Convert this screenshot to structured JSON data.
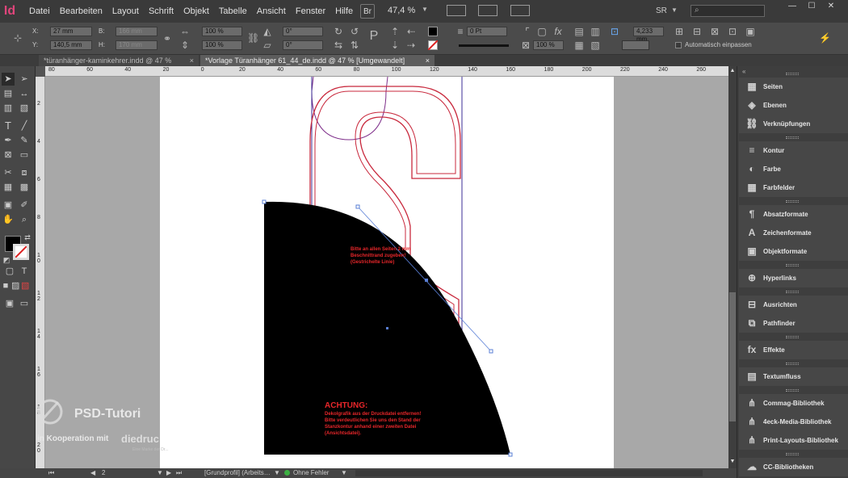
{
  "app": {
    "logo": "Id"
  },
  "menu": [
    "Datei",
    "Bearbeiten",
    "Layout",
    "Schrift",
    "Objekt",
    "Tabelle",
    "Ansicht",
    "Fenster",
    "Hilfe"
  ],
  "menubar": {
    "br_button": "Br",
    "zoom": "47,4 %",
    "workspace": "SR",
    "search_placeholder": ""
  },
  "window_controls": {
    "minimize": "—",
    "maximize": "☐",
    "close": "✕"
  },
  "control": {
    "x_label": "X:",
    "x_value": "27 mm",
    "y_label": "Y:",
    "y_value": "140,5 mm",
    "b_label": "B:",
    "b_value": "166 mm",
    "h_label": "H:",
    "h_value": "170 mm",
    "scale_x": "100 %",
    "scale_y": "100 %",
    "angle1": "0°",
    "angle2": "0°",
    "stroke_weight": "0 Pt",
    "opacity": "100 %",
    "offset": "4,233 mm",
    "autofit": "Automatisch einpassen"
  },
  "tabs": [
    {
      "label": "*türanhänger-kaminkehrer.indd @ 47 %",
      "close": "×"
    },
    {
      "label": "*Vorlage Türanhänger 61_44_de.indd @ 47 % [Umgewandelt]",
      "close": "×"
    }
  ],
  "ruler_top": [
    "80",
    "60",
    "40",
    "20",
    "0",
    "20",
    "40",
    "60",
    "80",
    "100",
    "120",
    "140",
    "160",
    "180",
    "200",
    "220",
    "240",
    "260"
  ],
  "ruler_left": [
    "2",
    "4",
    "6",
    "8",
    "1\n0",
    "1\n2",
    "1\n4",
    "1\n6",
    "1\n8",
    "2\n0"
  ],
  "canvas": {
    "note1": [
      "Bitte an allen Seiten 2 mm",
      "Beschnittrand zugeben!",
      "(Gestrichelte Linie)"
    ],
    "warning_title": "ACHTUNG:",
    "warning_lines": [
      "Dekolgrafik aus der Druckdatei entfernen!",
      "Bitte verdeutlichen Sie uns den Stand der",
      "Stanzkontur anhand einer zweiten Datei",
      "(Ansichtsdatei)."
    ]
  },
  "status": {
    "page": "2",
    "profile": "[Grundprofil] (Arbeits…",
    "errors": "Ohne Fehler"
  },
  "watermark": {
    "brand": "PSD-Tutori",
    "coop": "in Kooperation mit",
    "partner": "diedruc",
    "tag": "Eine Marke der Dr..."
  },
  "panels": [
    {
      "group": [
        {
          "icon": "pages-icon",
          "glyph": "▦",
          "label": "Seiten"
        },
        {
          "icon": "layers-icon",
          "glyph": "◈",
          "label": "Ebenen"
        },
        {
          "icon": "links-icon",
          "glyph": "⛓",
          "label": "Verknüpfungen"
        }
      ]
    },
    {
      "group": [
        {
          "icon": "stroke-icon",
          "glyph": "≡",
          "label": "Kontur"
        },
        {
          "icon": "color-icon",
          "glyph": "◐",
          "label": "Farbe"
        },
        {
          "icon": "swatches-icon",
          "glyph": "▦",
          "label": "Farbfelder"
        }
      ]
    },
    {
      "group": [
        {
          "icon": "paragraph-styles-icon",
          "glyph": "¶",
          "label": "Absatzformate"
        },
        {
          "icon": "character-styles-icon",
          "glyph": "A",
          "label": "Zeichenformate"
        },
        {
          "icon": "object-styles-icon",
          "glyph": "▣",
          "label": "Objektformate"
        }
      ]
    },
    {
      "group": [
        {
          "icon": "hyperlinks-icon",
          "glyph": "⊕",
          "label": "Hyperlinks"
        }
      ]
    },
    {
      "group": [
        {
          "icon": "align-icon",
          "glyph": "⊟",
          "label": "Ausrichten"
        },
        {
          "icon": "pathfinder-icon",
          "glyph": "⧉",
          "label": "Pathfinder"
        }
      ]
    },
    {
      "group": [
        {
          "icon": "effects-icon",
          "glyph": "fx",
          "label": "Effekte"
        }
      ]
    },
    {
      "group": [
        {
          "icon": "text-wrap-icon",
          "glyph": "▤",
          "label": "Textumfluss"
        }
      ]
    },
    {
      "group": [
        {
          "icon": "library-icon",
          "glyph": "⋔",
          "label": "Commag-Bibliothek"
        },
        {
          "icon": "library-icon",
          "glyph": "⋔",
          "label": "4eck-Media-Bibliothek"
        },
        {
          "icon": "library-icon",
          "glyph": "⋔",
          "label": "Print-Layouts-Bibliothek"
        }
      ]
    },
    {
      "group": [
        {
          "icon": "cc-libraries-icon",
          "glyph": "☁",
          "label": "CC-Bibliotheken"
        }
      ]
    }
  ],
  "colors": {
    "accent": "#e0457b",
    "guide_red": "#c8283c",
    "anchor_blue": "#5a7fd6"
  }
}
